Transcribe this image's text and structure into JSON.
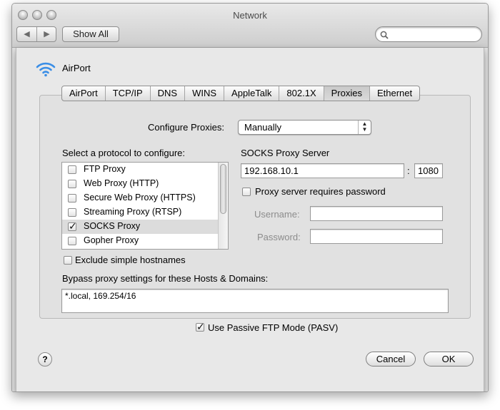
{
  "window": {
    "title": "Network"
  },
  "toolbar": {
    "back_glyph": "◀",
    "forward_glyph": "▶",
    "show_all_label": "Show All",
    "search_placeholder": ""
  },
  "interface": {
    "name": "AirPort"
  },
  "tabs": [
    {
      "label": "AirPort",
      "active": false
    },
    {
      "label": "TCP/IP",
      "active": false
    },
    {
      "label": "DNS",
      "active": false
    },
    {
      "label": "WINS",
      "active": false
    },
    {
      "label": "AppleTalk",
      "active": false
    },
    {
      "label": "802.1X",
      "active": false
    },
    {
      "label": "Proxies",
      "active": true
    },
    {
      "label": "Ethernet",
      "active": false
    }
  ],
  "configure": {
    "label": "Configure Proxies:",
    "value": "Manually"
  },
  "protocols": {
    "label": "Select a protocol to configure:",
    "items": [
      {
        "label": "FTP Proxy",
        "checked": false
      },
      {
        "label": "Web Proxy (HTTP)",
        "checked": false
      },
      {
        "label": "Secure Web Proxy (HTTPS)",
        "checked": false
      },
      {
        "label": "Streaming Proxy (RTSP)",
        "checked": false
      },
      {
        "label": "SOCKS Proxy",
        "checked": true
      },
      {
        "label": "Gopher Proxy",
        "checked": false
      }
    ]
  },
  "server": {
    "label": "SOCKS Proxy Server",
    "address": "192.168.10.1",
    "separator": ":",
    "port": "1080",
    "password_required_label": "Proxy server requires password",
    "username_label": "Username:",
    "username_value": "",
    "password_label": "Password:",
    "password_value": ""
  },
  "exclude_simple": {
    "label": "Exclude simple hostnames",
    "checked": false
  },
  "bypass": {
    "label": "Bypass proxy settings for these Hosts & Domains:",
    "value": "*.local, 169.254/16"
  },
  "passive_ftp": {
    "label": "Use Passive FTP Mode (PASV)",
    "checked": true
  },
  "buttons": {
    "help": "?",
    "cancel": "Cancel",
    "ok": "OK"
  }
}
